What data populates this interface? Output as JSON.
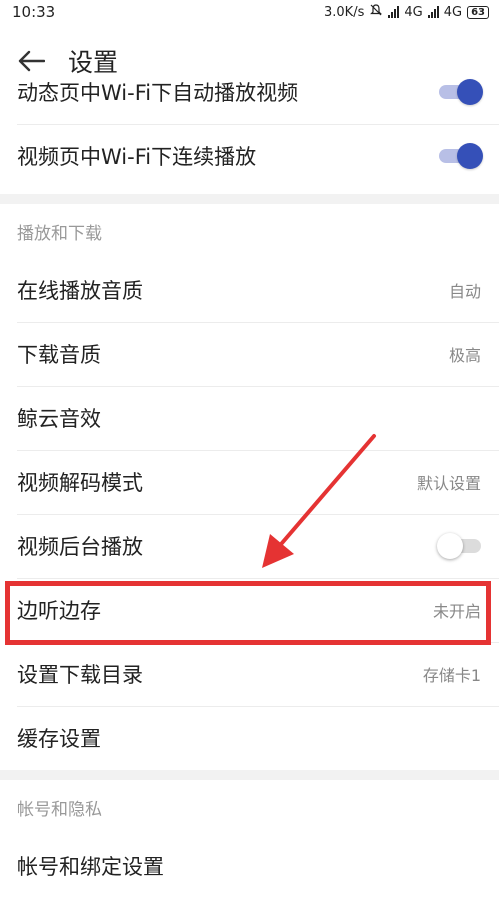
{
  "status": {
    "time": "10:33",
    "speed": "3.0K/s",
    "net1": "4G",
    "net2": "4G",
    "battery": "63"
  },
  "header": {
    "title": "设置"
  },
  "top_rows": [
    {
      "label": "动态页中Wi-Fi下自动播放视频",
      "toggle": "on"
    },
    {
      "label": "视频页中Wi-Fi下连续播放",
      "toggle": "on"
    }
  ],
  "playback": {
    "section_title": "播放和下载",
    "rows": [
      {
        "label": "在线播放音质",
        "value": "自动"
      },
      {
        "label": "下载音质",
        "value": "极高"
      },
      {
        "label": "鲸云音效",
        "value": ""
      },
      {
        "label": "视频解码模式",
        "value": "默认设置"
      },
      {
        "label": "视频后台播放",
        "toggle": "off"
      },
      {
        "label": "边听边存",
        "value": "未开启"
      },
      {
        "label": "设置下载目录",
        "value": "存储卡1"
      },
      {
        "label": "缓存设置",
        "value": ""
      }
    ]
  },
  "account": {
    "section_title": "帐号和隐私",
    "rows": [
      {
        "label": "帐号和绑定设置"
      }
    ]
  },
  "colors": {
    "accent": "#3550b8",
    "highlight": "#e53333"
  }
}
